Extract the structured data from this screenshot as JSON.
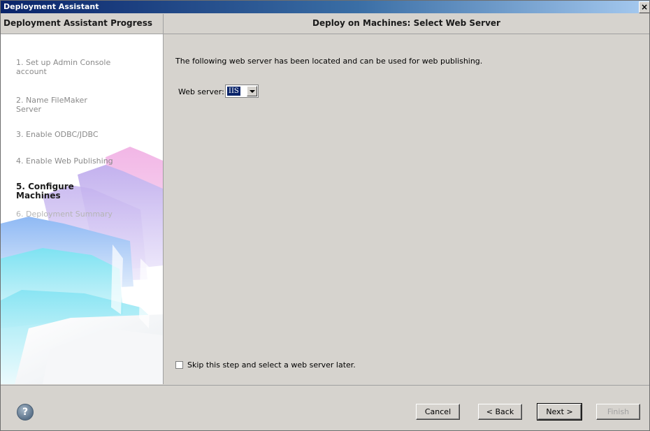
{
  "window": {
    "title": "Deployment Assistant",
    "close_label": "×"
  },
  "sidebar": {
    "header": "Deployment Assistant Progress",
    "steps": [
      {
        "label": "1. Set up Admin Console account",
        "state": "done"
      },
      {
        "label": "2. Name FileMaker Server",
        "state": "done"
      },
      {
        "label": "3. Enable ODBC/JDBC",
        "state": "done"
      },
      {
        "label": "4. Enable Web Publishing",
        "state": "done"
      },
      {
        "label": "5. Configure Machines",
        "state": "active"
      },
      {
        "label": "6. Deployment Summary",
        "state": "future"
      }
    ]
  },
  "main": {
    "header": "Deploy on Machines: Select Web Server",
    "intro": "The following web server has been located and can be used for web publishing.",
    "web_server_label": "Web server:",
    "web_server_value": "IIS",
    "skip_label": "Skip this step and select a web server later.",
    "skip_checked": false
  },
  "footer": {
    "help_label": "?",
    "cancel_label": "Cancel",
    "back_label": "< Back",
    "next_label": "Next >",
    "finish_label": "Finish"
  },
  "colors": {
    "title_bar": "#0a246a",
    "dialog_bg": "#d6d3ce",
    "selection": "#0a246a",
    "folder_pink": "#e9a9dc",
    "folder_purple": "#b7a7e6",
    "folder_blue": "#8fb6f0",
    "folder_cyan": "#7fe0f0"
  }
}
